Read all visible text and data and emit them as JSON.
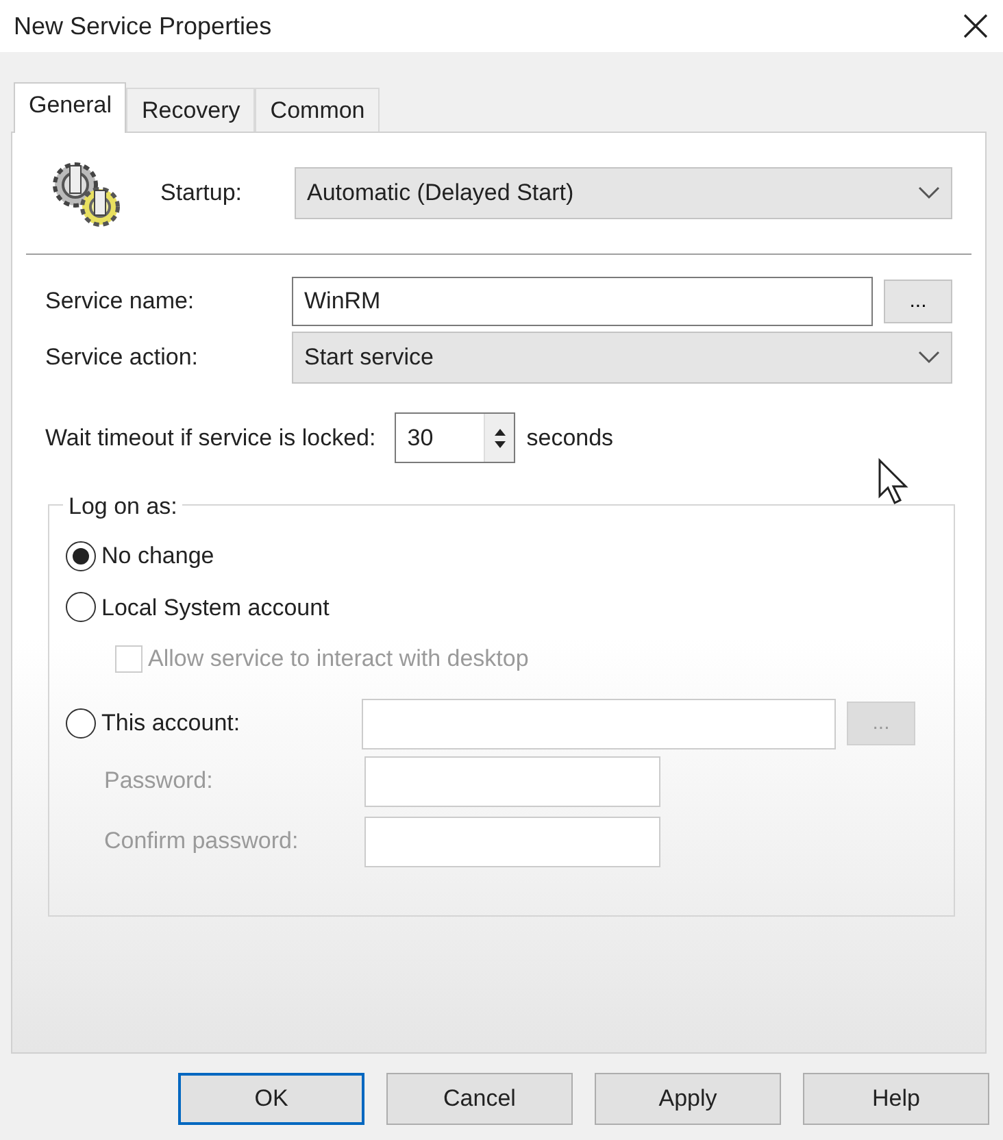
{
  "window": {
    "title": "New Service Properties"
  },
  "tabs": [
    {
      "label": "General",
      "selected": true
    },
    {
      "label": "Recovery",
      "selected": false
    },
    {
      "label": "Common",
      "selected": false
    }
  ],
  "startup": {
    "label": "Startup:",
    "value": "Automatic (Delayed Start)"
  },
  "service_name": {
    "label": "Service name:",
    "value": "WinRM",
    "browse_button": "..."
  },
  "service_action": {
    "label": "Service action:",
    "value": "Start service"
  },
  "wait_timeout": {
    "label": "Wait timeout if service is locked:",
    "value": "30",
    "unit": "seconds"
  },
  "log_on": {
    "title": "Log on as:",
    "options": [
      {
        "label": "No change",
        "selected": true
      },
      {
        "label": "Local System account",
        "selected": false
      },
      {
        "label": "This account:",
        "selected": false
      }
    ],
    "interact": {
      "label": "Allow service to interact with desktop",
      "checked": false,
      "disabled": true
    },
    "account": {
      "browse_button": "...",
      "disabled": true
    },
    "password": {
      "label": "Password:",
      "disabled": true
    },
    "confirm_password": {
      "label": "Confirm password:",
      "disabled": true
    }
  },
  "buttons": [
    {
      "label": "OK",
      "default": true
    },
    {
      "label": "Cancel",
      "default": false
    },
    {
      "label": "Apply",
      "default": false
    },
    {
      "label": "Help",
      "default": false
    }
  ]
}
